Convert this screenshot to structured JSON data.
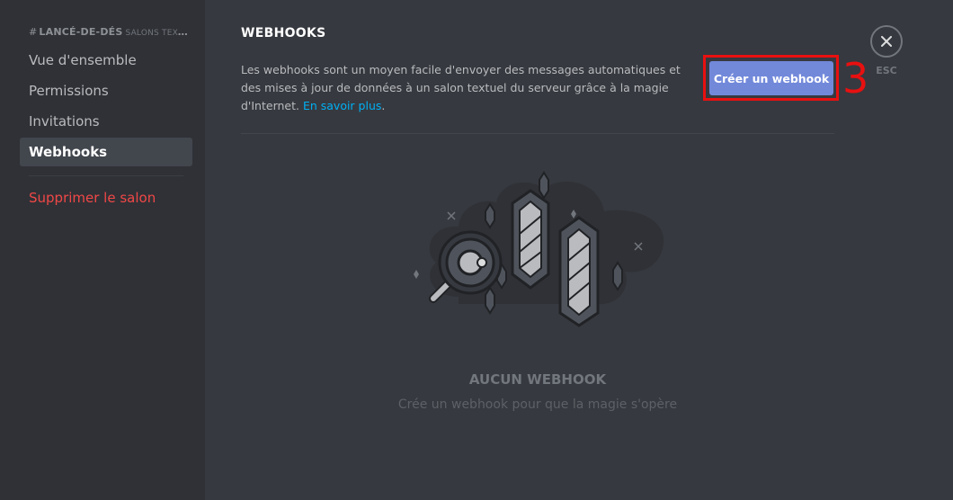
{
  "sidebar": {
    "channel_name": "LANCÉ-DE-DÉS",
    "channel_prefix": "#",
    "channel_category": "SALONS TEXTUELS",
    "items": [
      {
        "label": "Vue d'ensemble"
      },
      {
        "label": "Permissions"
      },
      {
        "label": "Invitations"
      },
      {
        "label": "Webhooks",
        "active": true
      }
    ],
    "delete_label": "Supprimer le salon"
  },
  "main": {
    "title": "WEBHOOKS",
    "description": "Les webhooks sont un moyen facile d'envoyer des messages automatiques et des mises à jour de données à un salon textuel du serveur grâce à la magie d'Internet. ",
    "learn_more": "En savoir plus",
    "description_end": ".",
    "create_button": "Créer un webhook",
    "annotation_number": "3",
    "empty_title": "AUCUN WEBHOOK",
    "empty_subtitle": "Crée un webhook pour que la magie s'opère"
  },
  "close": {
    "label": "ESC",
    "icon": "close-icon"
  },
  "colors": {
    "background": "#36393f",
    "sidebar": "#2f3136",
    "accent": "#7289da",
    "danger": "#f04747",
    "link": "#00b0f4",
    "annotation": "#e81010"
  }
}
